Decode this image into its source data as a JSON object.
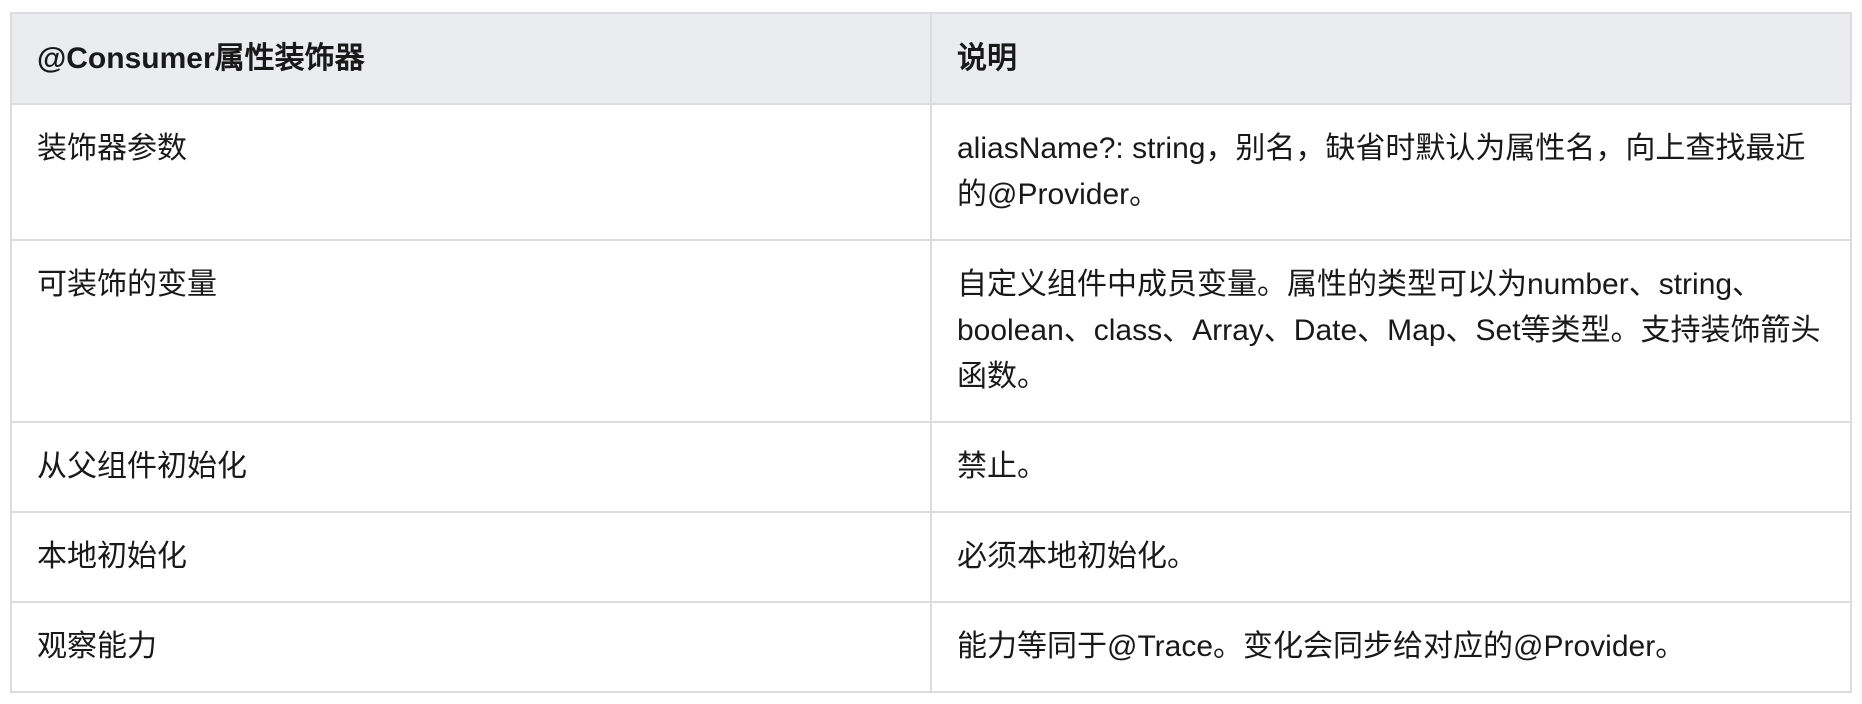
{
  "table": {
    "headers": [
      "@Consumer属性装饰器",
      "说明"
    ],
    "rows": [
      {
        "name": "装饰器参数",
        "desc": "aliasName?: string，别名，缺省时默认为属性名，向上查找最近的@Provider。"
      },
      {
        "name": "可装饰的变量",
        "desc": "自定义组件中成员变量。属性的类型可以为number、string、boolean、class、Array、Date、Map、Set等类型。支持装饰箭头函数。"
      },
      {
        "name": "从父组件初始化",
        "desc": "禁止。"
      },
      {
        "name": "本地初始化",
        "desc": "必须本地初始化。"
      },
      {
        "name": "观察能力",
        "desc": "能力等同于@Trace。变化会同步给对应的@Provider。"
      }
    ]
  }
}
